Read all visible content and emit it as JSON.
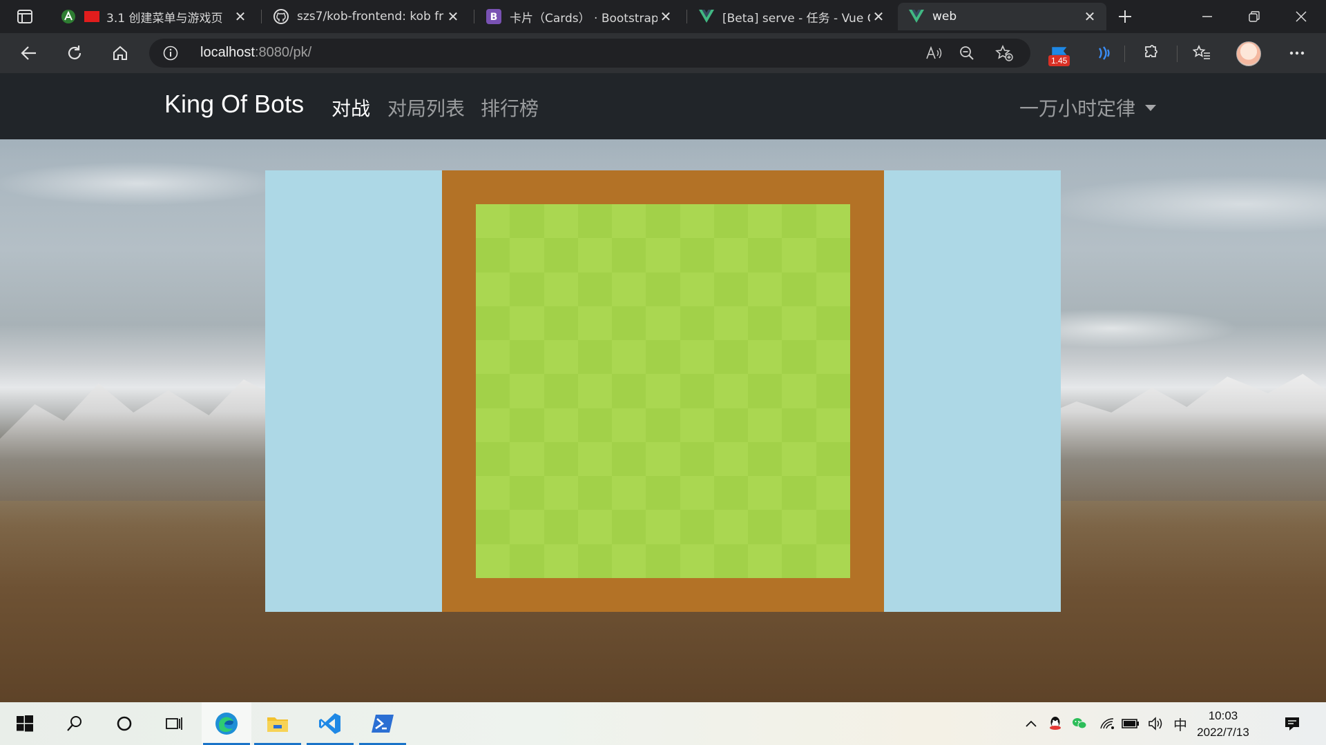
{
  "browser": {
    "tabs": [
      {
        "title": "3.1 创建菜单与游戏页",
        "icon": "acwing-icon",
        "active": false
      },
      {
        "title": "szs7/kob-frontend: kob fr",
        "icon": "github-icon",
        "active": false
      },
      {
        "title": "卡片（Cards） · Bootstrap",
        "icon": "bootstrap-icon",
        "active": false
      },
      {
        "title": "[Beta] serve - 任务 - Vue C",
        "icon": "vue-icon",
        "active": false
      },
      {
        "title": "web",
        "icon": "vue-icon",
        "active": true
      }
    ],
    "address": {
      "host": "localhost",
      "rest": ":8080/pk/"
    },
    "extension_badge": "1.45"
  },
  "app": {
    "brand": "King Of Bots",
    "nav": [
      {
        "label": "对战",
        "active": true
      },
      {
        "label": "对局列表",
        "active": false
      },
      {
        "label": "排行榜",
        "active": false
      }
    ],
    "user": "一万小时定律"
  },
  "game": {
    "rows": 13,
    "cols": 13,
    "colors": {
      "wall": "#b37226",
      "grass_even": "#aad751",
      "grass_odd": "#a2d149",
      "playground": "#add8e6"
    }
  },
  "taskbar": {
    "ime": "中",
    "time": "10:03",
    "date": "2022/7/13"
  }
}
